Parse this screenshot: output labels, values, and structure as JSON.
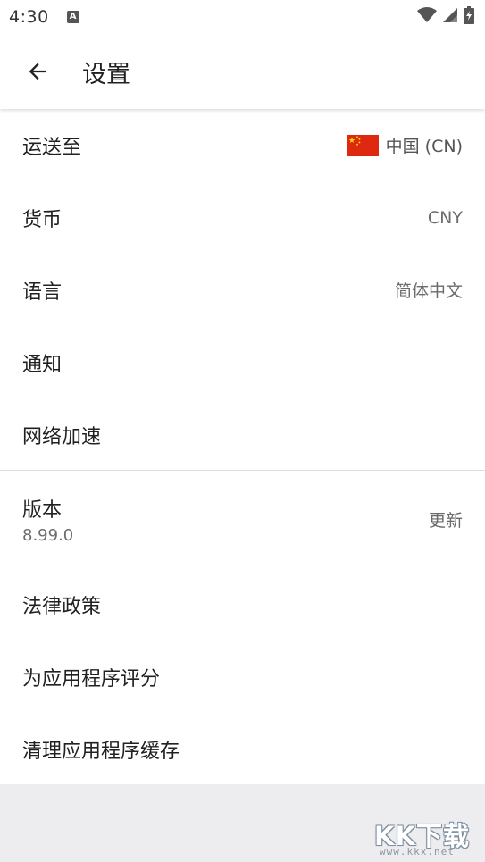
{
  "status_bar": {
    "time": "4:30",
    "notification_icon": "A"
  },
  "app_bar": {
    "title": "设置"
  },
  "settings": {
    "items": [
      {
        "label": "运送至",
        "value": "中国 (CN)",
        "icon": "china-flag-icon"
      },
      {
        "label": "货币",
        "value": "CNY"
      },
      {
        "label": "语言",
        "value": "简体中文"
      },
      {
        "label": "通知"
      },
      {
        "label": "网络加速"
      }
    ],
    "items2": [
      {
        "label": "版本",
        "sublabel": "8.99.0",
        "value": "更新"
      },
      {
        "label": "法律政策"
      },
      {
        "label": "为应用程序评分"
      },
      {
        "label": "清理应用程序缓存"
      }
    ]
  },
  "watermark": {
    "main": "KK下载",
    "sub": "www.kkx.net"
  },
  "colors": {
    "background": "#ededf0",
    "surface": "#ffffff",
    "flag_red": "#de2910",
    "flag_star": "#ffde00"
  }
}
